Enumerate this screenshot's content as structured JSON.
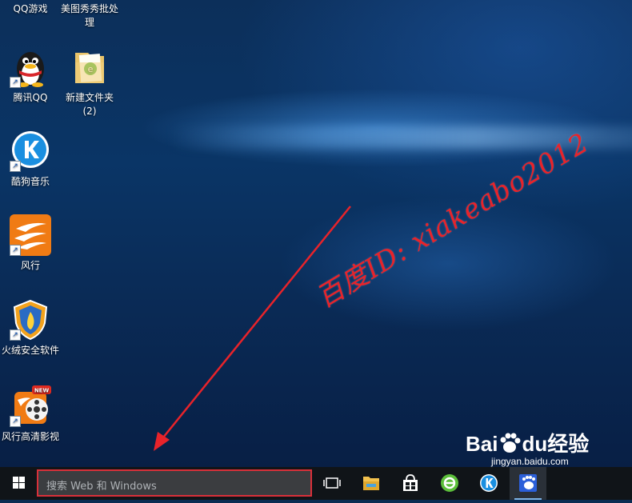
{
  "desktop": {
    "icons": [
      {
        "label": "QQ游戏"
      },
      {
        "label": "美图秀秀批处理"
      },
      {
        "label": "腾讯QQ"
      },
      {
        "label": "新建文件夹(2)"
      },
      {
        "label": "酷狗音乐"
      },
      {
        "label": "风行"
      },
      {
        "label": "火绒安全软件"
      },
      {
        "label": "风行高清影视"
      }
    ]
  },
  "overlay": {
    "watermark": "百度ID: xiakeabo2012",
    "baidu_brand": "Bai",
    "baidu_du": "du",
    "baidu_jingyan": "经验",
    "baidu_site": "jingyan.baidu.com",
    "new_badge": "NEW"
  },
  "taskbar": {
    "search_placeholder": "搜索 Web 和 Windows",
    "items": [
      "task-view",
      "file-explorer",
      "store",
      "browser",
      "kugou",
      "baidu"
    ]
  },
  "colors": {
    "annotation_red": "#e8232a",
    "taskbar_bg": "#101418",
    "search_bg": "#3b3d40"
  }
}
